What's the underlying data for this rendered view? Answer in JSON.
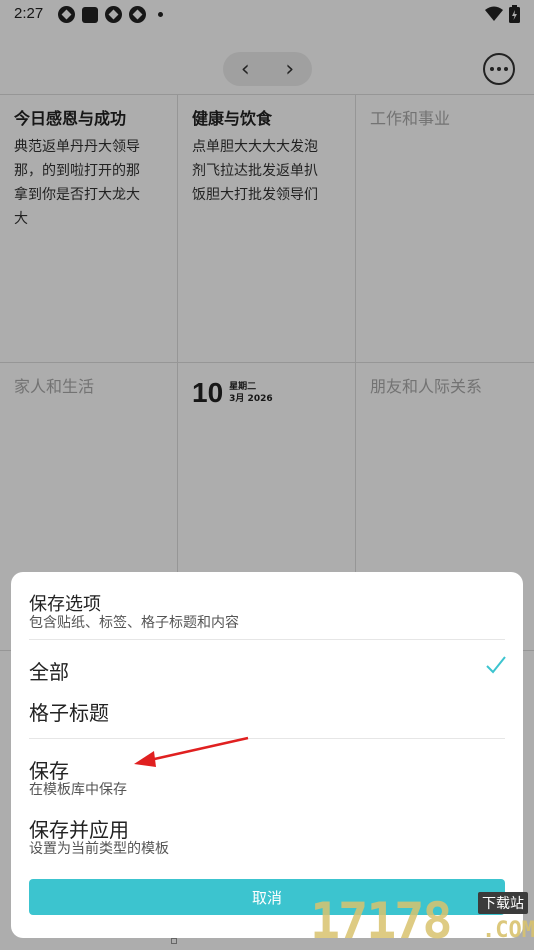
{
  "status_bar": {
    "time": "2:27"
  },
  "header": {
    "prev_label": "‹",
    "next_label": "›"
  },
  "grid": {
    "cells": [
      {
        "title": "今日感恩与成功",
        "body": [
          "典范返单丹丹大领导",
          "那，的到啦打开的那",
          "拿到你是否打大龙大",
          "大"
        ]
      },
      {
        "title": "健康与饮食",
        "body": [
          "点单胆大大大大发泡",
          "剂飞拉达批发返单扒",
          "饭胆大打批发领导们"
        ]
      },
      {
        "title": "工作和事业",
        "body": []
      },
      {
        "title": "家人和生活",
        "body": []
      },
      {
        "date_day": "10",
        "date_weekday": "星期二",
        "date_month": "3月 2026"
      },
      {
        "title": "朋友和人际关系",
        "body": []
      }
    ]
  },
  "sheet": {
    "title": "保存选项",
    "subtitle": "包含贴纸、标签、格子标题和内容",
    "scope_options": [
      {
        "label": "全部",
        "selected": true
      },
      {
        "label": "格子标题",
        "selected": false
      }
    ],
    "actions": [
      {
        "label": "保存",
        "description": "在模板库中保存"
      },
      {
        "label": "保存并应用",
        "description": "设置为当前类型的模板"
      }
    ],
    "cancel_label": "取消",
    "accent_color": "#3cc4cf"
  },
  "annotation": {
    "arrow_color": "#e02020"
  },
  "watermark": {
    "number": "17178",
    "tag": "下载站",
    "domain": ".COM"
  }
}
